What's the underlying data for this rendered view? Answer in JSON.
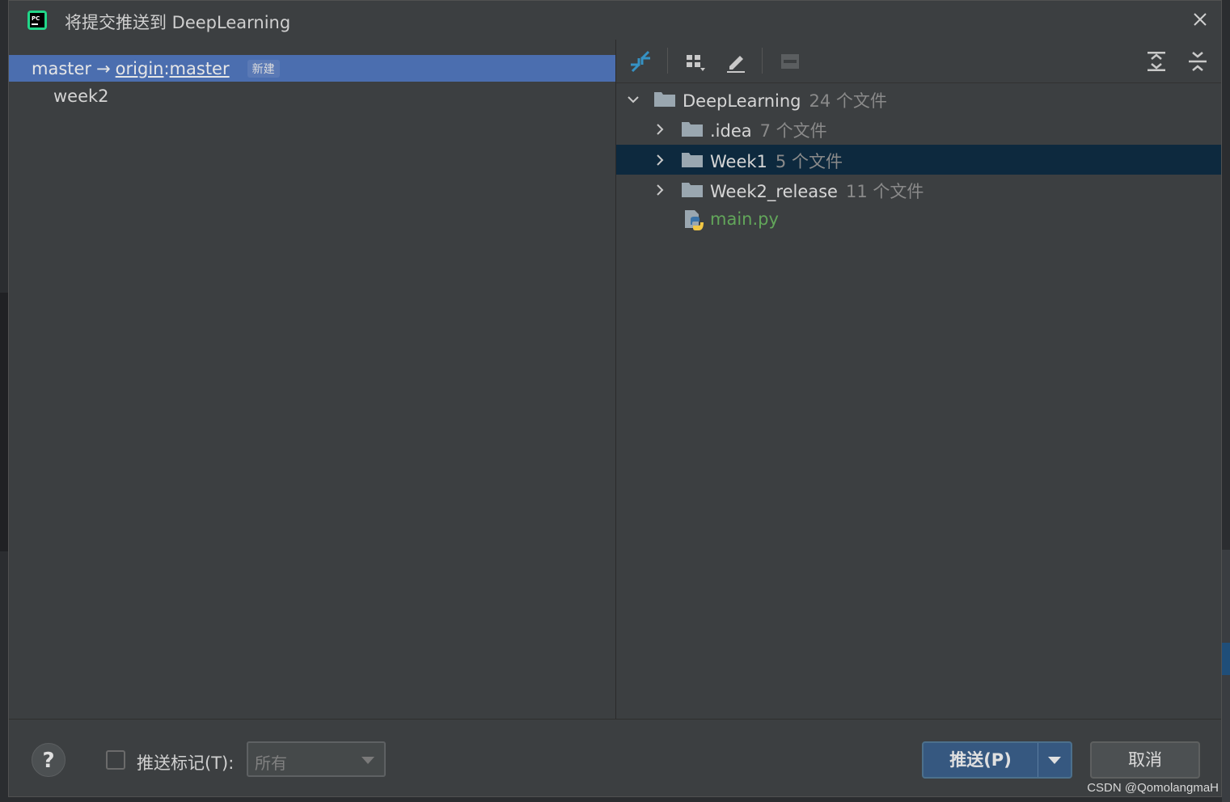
{
  "window": {
    "title": "将提交推送到 DeepLearning",
    "app_icon": "pycharm-icon",
    "close_icon": "close-icon"
  },
  "branches": {
    "local": "master",
    "arrow": "→",
    "remote": "origin",
    "separator": ":",
    "remote_branch": "master",
    "badge": "新建",
    "commits": [
      "week2"
    ]
  },
  "toolbar": {
    "icons": [
      "expand-diff-icon",
      "group-by-icon",
      "edit-icon",
      "show-diff-icon",
      "expand-all-icon",
      "collapse-all-icon"
    ]
  },
  "tree": {
    "root": {
      "name": "DeepLearning",
      "count": "24 个文件"
    },
    "children": [
      {
        "name": ".idea",
        "count": "7 个文件"
      },
      {
        "name": "Week1",
        "count": "5 个文件"
      },
      {
        "name": "Week2_release",
        "count": "11 个文件"
      }
    ],
    "file": {
      "name": "main.py"
    }
  },
  "footer": {
    "help_label": "?",
    "push_tags_label": "推送标记(T):",
    "push_tags_checked": false,
    "tags_select_value": "所有",
    "push_button": "推送(P)",
    "cancel_button": "取消"
  },
  "watermark": "CSDN @QomolangmaH",
  "colors": {
    "selection": "#4b6eaf",
    "tree_selection": "#0d293e",
    "primary_button": "#365880",
    "python_file": "#62a65a"
  }
}
